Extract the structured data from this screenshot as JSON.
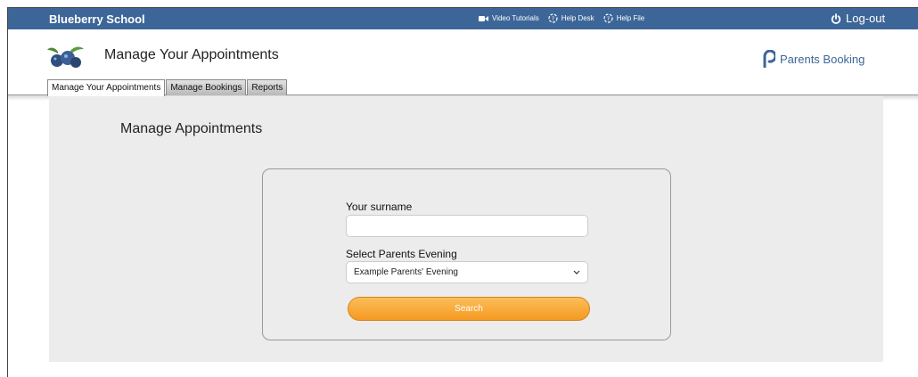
{
  "topbar": {
    "school_name": "Blueberry School",
    "links": [
      {
        "label": "Video Tutorials",
        "icon": "video-camera-icon"
      },
      {
        "label": "Help Desk",
        "icon": "help-desk-icon"
      },
      {
        "label": "Help File",
        "icon": "help-file-icon"
      }
    ],
    "logout_label": "Log-out",
    "logout_icon": "power-icon",
    "bar_color": "#3d6698"
  },
  "header": {
    "title": "Manage Your Appointments",
    "logo_icon": "blueberry-logo-icon",
    "brand_name": "Parents Booking",
    "brand_icon": "parents-booking-logo-icon"
  },
  "tabs": [
    {
      "label": "Manage Your Appointments",
      "active": true
    },
    {
      "label": "Manage Bookings",
      "active": false
    },
    {
      "label": "Reports",
      "active": false
    }
  ],
  "main": {
    "section_title": "Manage Appointments",
    "form": {
      "surname_label": "Your surname",
      "surname_value": "",
      "evening_label": "Select Parents Evening",
      "evening_selected": "Example Parents' Evening",
      "search_label": "Search",
      "search_color": "#f5a02a"
    }
  }
}
